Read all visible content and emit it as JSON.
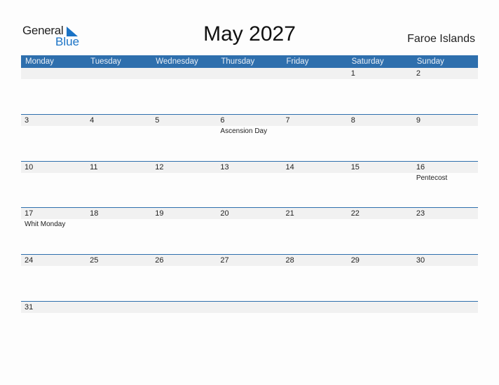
{
  "logo": {
    "text1": "General",
    "text2": "Blue"
  },
  "title": "May 2027",
  "country": "Faroe Islands",
  "colors": {
    "accent": "#2e6fad",
    "stripe": "#f1f1f1",
    "logo_blue": "#1a73c6"
  },
  "weekdays": [
    "Monday",
    "Tuesday",
    "Wednesday",
    "Thursday",
    "Friday",
    "Saturday",
    "Sunday"
  ],
  "weeks": [
    [
      {
        "d": ""
      },
      {
        "d": ""
      },
      {
        "d": ""
      },
      {
        "d": ""
      },
      {
        "d": ""
      },
      {
        "d": "1"
      },
      {
        "d": "2"
      }
    ],
    [
      {
        "d": "3"
      },
      {
        "d": "4"
      },
      {
        "d": "5"
      },
      {
        "d": "6",
        "e": "Ascension Day"
      },
      {
        "d": "7"
      },
      {
        "d": "8"
      },
      {
        "d": "9"
      }
    ],
    [
      {
        "d": "10"
      },
      {
        "d": "11"
      },
      {
        "d": "12"
      },
      {
        "d": "13"
      },
      {
        "d": "14"
      },
      {
        "d": "15"
      },
      {
        "d": "16",
        "e": "Pentecost"
      }
    ],
    [
      {
        "d": "17",
        "e": "Whit Monday"
      },
      {
        "d": "18"
      },
      {
        "d": "19"
      },
      {
        "d": "20"
      },
      {
        "d": "21"
      },
      {
        "d": "22"
      },
      {
        "d": "23"
      }
    ],
    [
      {
        "d": "24"
      },
      {
        "d": "25"
      },
      {
        "d": "26"
      },
      {
        "d": "27"
      },
      {
        "d": "28"
      },
      {
        "d": "29"
      },
      {
        "d": "30"
      }
    ],
    [
      {
        "d": "31"
      },
      {
        "d": ""
      },
      {
        "d": ""
      },
      {
        "d": ""
      },
      {
        "d": ""
      },
      {
        "d": ""
      },
      {
        "d": ""
      }
    ]
  ]
}
